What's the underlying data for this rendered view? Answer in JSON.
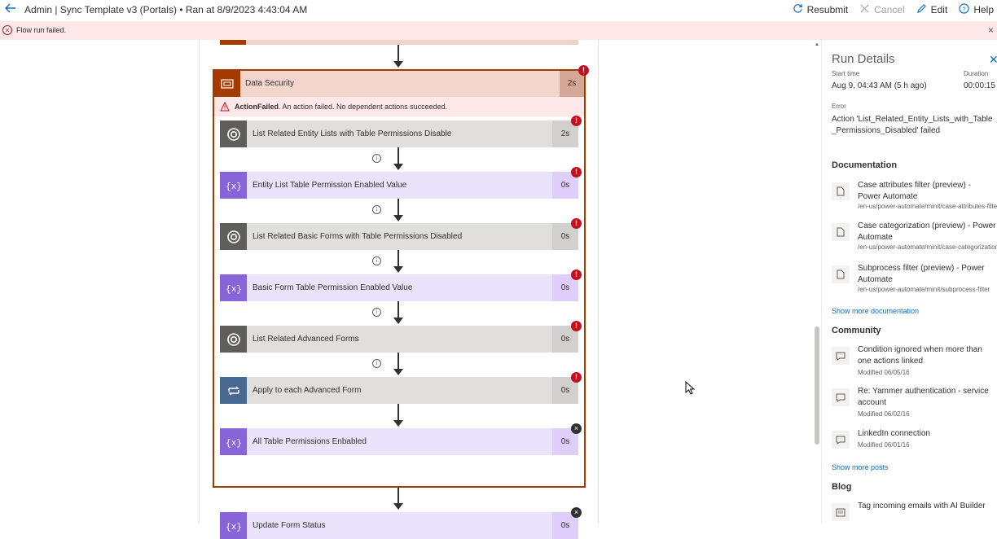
{
  "header": {
    "title": "Admin | Sync Template v3 (Portals) • Ran at 8/9/2023 4:43:04 AM",
    "resubmit": "Resubmit",
    "cancel": "Cancel",
    "edit": "Edit",
    "help": "Help"
  },
  "error_bar": {
    "message": "Flow run failed."
  },
  "scope": {
    "title": "Data Security",
    "duration": "2s",
    "fail_code": "ActionFailed",
    "fail_message": ". An action failed. No dependent actions succeeded."
  },
  "actions": [
    {
      "title": "List Related Entity Lists with Table Permissions Disable",
      "duration": "2s",
      "kind": "dataverse",
      "status": "failed"
    },
    {
      "title": "Entity List Table Permission Enabled Value",
      "duration": "0s",
      "kind": "variable",
      "status": "failed"
    },
    {
      "title": "List Related Basic Forms with Table Permissions Disabled",
      "duration": "0s",
      "kind": "dataverse",
      "status": "failed"
    },
    {
      "title": "Basic Form Table Permission Enabled Value",
      "duration": "0s",
      "kind": "variable",
      "status": "failed"
    },
    {
      "title": "List Related Advanced Forms",
      "duration": "0s",
      "kind": "dataverse",
      "status": "failed"
    },
    {
      "title": "Apply to each Advanced Form",
      "duration": "0s",
      "kind": "loop",
      "status": "failed"
    },
    {
      "title": "All Table Permissions Enbabled",
      "duration": "0s",
      "kind": "variable",
      "status": "skipped"
    }
  ],
  "next_card": {
    "title": "Update Form Status",
    "duration": "0s",
    "status": "skipped"
  },
  "run_details": {
    "title": "Run Details",
    "start_label": "Start time",
    "start_value": "Aug 9, 04:43 AM (5 h ago)",
    "duration_label": "Duration",
    "duration_value": "00:00:15",
    "error_label": "Error",
    "error_value": "Action 'List_Related_Entity_Lists_with_Table_Permissions_Disabled' failed",
    "documentation_head": "Documentation",
    "documentation": [
      {
        "title": "Case attributes filter (preview) - Power Automate",
        "path": "/en-us/power-automate/minit/case-attributes-filter"
      },
      {
        "title": "Case categorization (preview) - Power Automate",
        "path": "/en-us/power-automate/minit/case-categorization"
      },
      {
        "title": "Subprocess filter (preview) - Power Automate",
        "path": "/en-us/power-automate/minit/subprocess-filter"
      }
    ],
    "show_more_docs": "Show more documentation",
    "community_head": "Community",
    "community": [
      {
        "title": "Condition ignored when more than one actions linked",
        "modified": "Modified 06/05/16"
      },
      {
        "title": "Re: Yammer authentication - service account",
        "modified": "Modified 06/02/16"
      },
      {
        "title": "LinkedIn connection",
        "modified": "Modified 06/01/16"
      }
    ],
    "show_more_posts": "Show more posts",
    "blog_head": "Blog",
    "blog": [
      {
        "title": "Tag incoming emails with AI Builder"
      }
    ]
  },
  "colors": {
    "scope_accent": "#a33a00",
    "failed": "#c50f1f",
    "variable": "#8764d8",
    "dataverse": "#605e5c",
    "loop": "#486991",
    "link": "#0f6cbd"
  },
  "icons": {
    "back": "back-arrow-icon",
    "resubmit": "refresh-icon",
    "cancel": "close-icon",
    "edit": "pencil-icon",
    "help": "help-icon",
    "dataverse": "dataverse-icon",
    "variable": "variable-icon",
    "loop": "loop-icon",
    "doc": "document-icon",
    "community": "chat-icon"
  }
}
